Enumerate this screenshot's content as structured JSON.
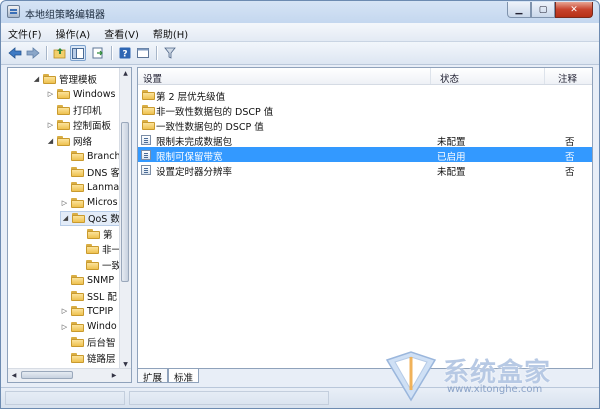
{
  "window": {
    "title": "本地组策略编辑器"
  },
  "menubar": [
    "文件(F)",
    "操作(A)",
    "查看(V)",
    "帮助(H)"
  ],
  "tree": [
    {
      "label": "管理模板",
      "indent": 1,
      "toggle": "◢"
    },
    {
      "label": "Windows",
      "indent": 2,
      "toggle": "▷"
    },
    {
      "label": "打印机",
      "indent": 2,
      "toggle": ""
    },
    {
      "label": "控制面板",
      "indent": 2,
      "toggle": "▷"
    },
    {
      "label": "网络",
      "indent": 2,
      "toggle": "◢"
    },
    {
      "label": "Branch",
      "indent": 3,
      "toggle": ""
    },
    {
      "label": "DNS 客",
      "indent": 3,
      "toggle": ""
    },
    {
      "label": "Lanma",
      "indent": 3,
      "toggle": ""
    },
    {
      "label": "Micros",
      "indent": 3,
      "toggle": "▷"
    },
    {
      "label": "QoS 数",
      "indent": 3,
      "toggle": "◢",
      "highlight": true
    },
    {
      "label": "第",
      "indent": 4,
      "toggle": ""
    },
    {
      "label": "非一",
      "indent": 4,
      "toggle": ""
    },
    {
      "label": "一致",
      "indent": 4,
      "toggle": ""
    },
    {
      "label": "SNMP",
      "indent": 3,
      "toggle": ""
    },
    {
      "label": "SSL 配",
      "indent": 3,
      "toggle": ""
    },
    {
      "label": "TCPIP",
      "indent": 3,
      "toggle": "▷"
    },
    {
      "label": "Windo",
      "indent": 3,
      "toggle": "▷"
    },
    {
      "label": "后台智",
      "indent": 3,
      "toggle": ""
    },
    {
      "label": "链路层",
      "indent": 3,
      "toggle": ""
    }
  ],
  "list": {
    "headers": {
      "setting": "设置",
      "state": "状态",
      "note": "注释"
    },
    "rows": [
      {
        "type": "folder",
        "name": "第 2 层优先级值",
        "state": "",
        "note": ""
      },
      {
        "type": "folder",
        "name": "非一致性数据包的 DSCP 值",
        "state": "",
        "note": ""
      },
      {
        "type": "folder",
        "name": "一致性数据包的 DSCP 值",
        "state": "",
        "note": ""
      },
      {
        "type": "policy",
        "name": "限制未完成数据包",
        "state": "未配置",
        "note": "否"
      },
      {
        "type": "policy",
        "name": "限制可保留带宽",
        "state": "已启用",
        "note": "否",
        "selected": true
      },
      {
        "type": "policy",
        "name": "设置定时器分辨率",
        "state": "未配置",
        "note": "否"
      }
    ]
  },
  "tabs": [
    "扩展",
    "标准"
  ],
  "watermark": {
    "text": "系统盒家",
    "url": "www.xitonghe.com"
  },
  "colors": {
    "selection": "#3399ff",
    "folder": "#eec150",
    "accent": "#3b6fb6"
  }
}
